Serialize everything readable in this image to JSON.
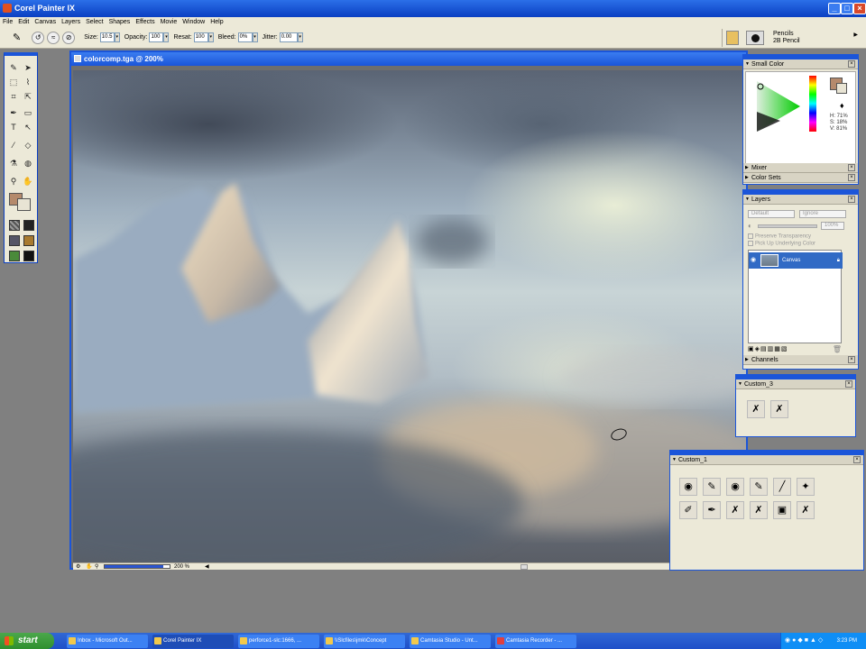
{
  "app": {
    "title": "Corel Painter IX",
    "window_buttons": [
      "_",
      "□",
      "×"
    ]
  },
  "menu": [
    "File",
    "Edit",
    "Canvas",
    "Layers",
    "Select",
    "Shapes",
    "Effects",
    "Movie",
    "Window",
    "Help"
  ],
  "property_bar": {
    "size_label": "Size:",
    "size_value": "10.5",
    "opacity_label": "Opacity:",
    "opacity_value": "100",
    "resat_label": "Resat:",
    "resat_value": "100",
    "bleed_label": "Bleed:",
    "bleed_value": "0%",
    "jitter_label": "Jitter:",
    "jitter_value": "0.00"
  },
  "brush_selector": {
    "category": "Pencils",
    "variant": "2B Pencil"
  },
  "document": {
    "title": "colorcomp.tga @ 200%",
    "zoom": "200 %"
  },
  "panels": {
    "small_color": {
      "title": "Small Color",
      "h": "H: 71%",
      "s": "S: 18%",
      "v": "V: 81%",
      "main_color": "#b58a6c",
      "additional_color": "#e8e4d4"
    },
    "mixer": {
      "title": "Mixer"
    },
    "color_sets": {
      "title": "Color Sets"
    },
    "layers": {
      "title": "Layers",
      "composite_method": "Default",
      "depth": "Ignore",
      "opacity": "100%",
      "preserve_transparency": "Preserve Transparency",
      "pick_up_underlying": "Pick Up Underlying Color",
      "items": [
        {
          "name": "Canvas"
        }
      ]
    },
    "channels": {
      "title": "Channels"
    },
    "custom3": {
      "title": "Custom_3"
    },
    "custom1": {
      "title": "Custom_1"
    }
  },
  "taskbar": {
    "start": "start",
    "tasks": [
      "Inbox - Microsoft Out...",
      "Corel Painter IX",
      "perforce1-slc:1666, ...",
      "\\\\Slcfiles\\jmk\\Concept",
      "Camtasia Studio - Unt...",
      "Camtasia Recorder - ..."
    ],
    "clock": "3:23 PM"
  }
}
